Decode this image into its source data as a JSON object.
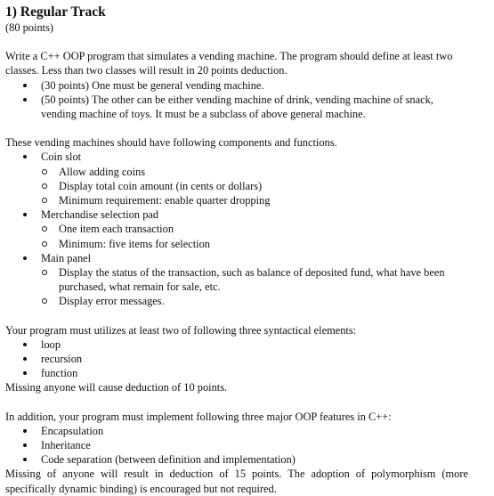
{
  "heading": {
    "title": "1) Regular Track",
    "points": "(80 points)"
  },
  "intro": {
    "text": "Write a C++ OOP program that simulates a vending machine. The program should define at least two classes. Less than two classes will result in 20 points deduction.",
    "items": [
      "(30 points) One must be general vending machine.",
      "(50 points) The other can be either vending machine of drink, vending machine of snack, vending machine of toys. It must be a subclass of above general machine."
    ]
  },
  "components": {
    "text": "These vending machines should have following components and functions.",
    "items": [
      {
        "label": "Coin slot",
        "subitems": [
          "Allow adding coins",
          "Display total coin amount (in cents or dollars)",
          "Minimum requirement: enable quarter dropping"
        ]
      },
      {
        "label": "Merchandise selection pad",
        "subitems": [
          "One item each transaction",
          "Minimum: five items for selection"
        ]
      },
      {
        "label": "Main panel",
        "subitems": [
          "Display the status of the transaction, such as balance of deposited fund, what have been purchased, what remain for sale, etc.",
          "Display error messages."
        ]
      }
    ]
  },
  "syntax": {
    "text": "Your program must utilizes at least two of following three syntactical elements:",
    "items": [
      "loop",
      "recursion",
      "function"
    ],
    "note": "Missing anyone will cause deduction of 10 points."
  },
  "oop": {
    "text": "In addition, your program must implement following three major OOP features in C++:",
    "items": [
      "Encapsulation",
      "Inheritance",
      "Code separation (between definition and implementation)"
    ],
    "note": "Missing of anyone will result in deduction of 15 points. The adoption of polymorphism (more specifically dynamic binding) is encouraged but not required."
  }
}
